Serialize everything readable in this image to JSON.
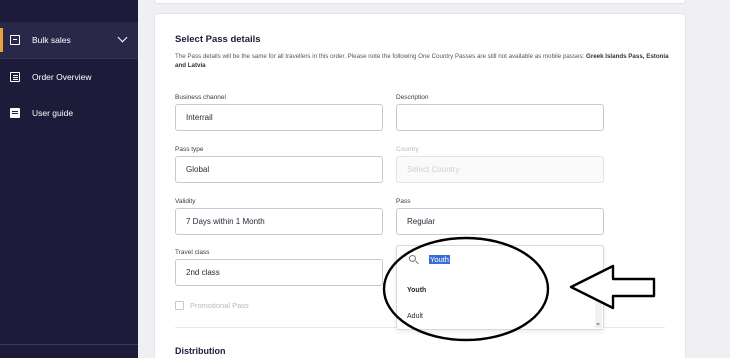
{
  "sidebar": {
    "items": [
      {
        "label": "Bulk sales",
        "icon": "bulk-sales-icon"
      },
      {
        "label": "Order Overview",
        "icon": "order-icon"
      },
      {
        "label": "User guide",
        "icon": "guide-icon"
      }
    ]
  },
  "section": {
    "title": "Select Pass details",
    "desc_main": "The Pass details will be the same for all travellers in this order. Please note the following One Country Passes are still not available as mobile passes: ",
    "desc_bold": "Greek Islands Pass, Estonia and Latvia"
  },
  "form": {
    "business_channel": {
      "label": "Business channel",
      "value": "Interrail"
    },
    "description": {
      "label": "Description",
      "value": ""
    },
    "pass_type": {
      "label": "Pass type",
      "value": "Global"
    },
    "country": {
      "label": "Country",
      "placeholder": "Select Country"
    },
    "validity": {
      "label": "Validity",
      "value": "7 Days within 1 Month"
    },
    "pass": {
      "label": "Pass",
      "value": "Regular"
    },
    "travel_class": {
      "label": "Travel class",
      "value": "2nd class"
    },
    "promotional": {
      "label": "Promotional Pass"
    }
  },
  "dropdown": {
    "query": "Youth",
    "options": [
      "Youth",
      "Adult"
    ],
    "selected": "Youth"
  },
  "distribution": {
    "title": "Distribution"
  },
  "colors": {
    "sidebar": "#1d1b3a",
    "accent": "#e8a33c",
    "highlight": "#3a6fd8"
  }
}
